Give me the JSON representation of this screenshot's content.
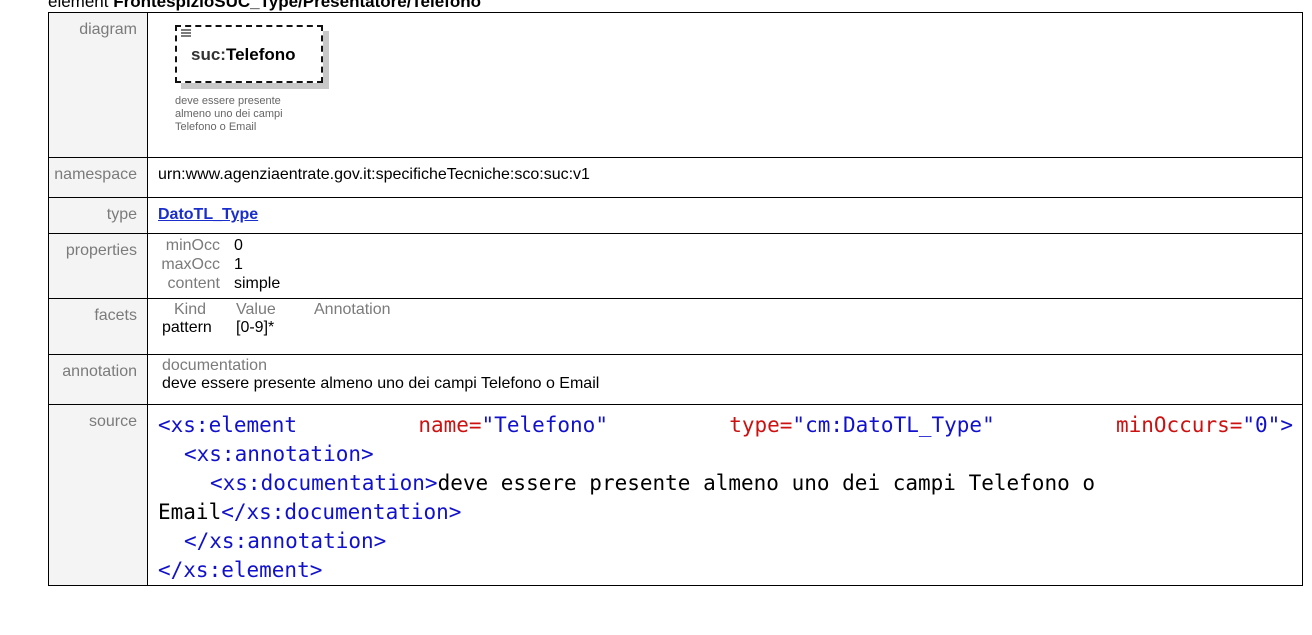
{
  "header": {
    "prefix": "element",
    "path": "FrontespizioSUC_Type/Presentatore/Telefono"
  },
  "rows": {
    "diagram": {
      "label": "diagram"
    },
    "namespace": {
      "label": "namespace",
      "value": "urn:www.agenziaentrate.gov.it:specificheTecniche:sco:suc:v1"
    },
    "type": {
      "label": "type",
      "value": "DatoTL_Type"
    },
    "properties": {
      "label": "properties",
      "items": [
        {
          "key": "minOcc",
          "value": "0"
        },
        {
          "key": "maxOcc",
          "value": "1"
        },
        {
          "key": "content",
          "value": "simple"
        }
      ]
    },
    "facets": {
      "label": "facets",
      "headers": [
        "Kind",
        "Value",
        "Annotation"
      ],
      "rows": [
        {
          "kind": "pattern",
          "value": "[0-9]*",
          "annotation": ""
        }
      ]
    },
    "annotation": {
      "label": "annotation",
      "header": "documentation",
      "text": "deve essere presente almeno uno dei campi Telefono o Email"
    },
    "source": {
      "label": "source"
    }
  },
  "diagram": {
    "namespace_prefix": "suc:",
    "element_name": "Telefono",
    "note_lines": [
      "deve essere presente",
      "almeno uno dei campi",
      "Telefono o Email"
    ]
  },
  "source_code": {
    "l1_open": "<xs:element",
    "l1_attr1": "name=",
    "l1_val1": "\"Telefono\"",
    "l1_attr2": "type=",
    "l1_val2": "\"cm:DatoTL_Type\"",
    "l1_attr3": "minOccurs=",
    "l1_val3": "\"0\"",
    "l1_close": ">",
    "l2": "<xs:annotation>",
    "l3_open": "<xs:documentation>",
    "l3_text": "deve essere presente almeno uno dei campi Telefono o",
    "l4_text": "Email",
    "l4_close": "</xs:documentation>",
    "l5": "</xs:annotation>",
    "l6": "</xs:element>"
  }
}
